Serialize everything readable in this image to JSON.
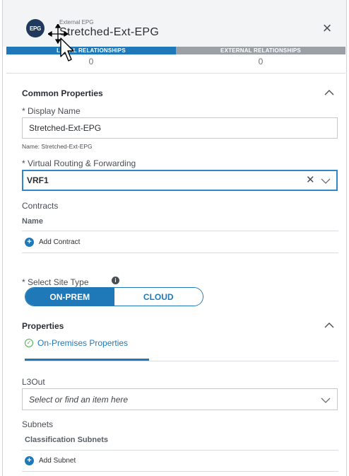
{
  "header": {
    "badge": "EPG",
    "object_type": "External EPG",
    "object_name": "Stretched-Ext-EPG",
    "close_label": "×"
  },
  "tabs": [
    {
      "label": "LOCAL RELATIONSHIPS",
      "count": "0",
      "active": true
    },
    {
      "label": "EXTERNAL RELATIONSHIPS",
      "count": "0",
      "active": false
    }
  ],
  "common": {
    "title": "Common Properties",
    "display_name_label": "* Display Name",
    "display_name_value": "Stretched-Ext-EPG",
    "name_hint": "Name: Stretched-Ext-EPG",
    "vrf_label": "* Virtual Routing & Forwarding",
    "vrf_value": "VRF1",
    "contracts_label": "Contracts",
    "contracts_col_header": "Name",
    "add_contract": "Add Contract"
  },
  "site_type": {
    "label": "* Select Site Type",
    "info_icon": "i",
    "options": [
      "ON-PREM",
      "CLOUD"
    ],
    "selected": "ON-PREM"
  },
  "properties": {
    "title": "Properties",
    "sub_tab": "On-Premises Properties",
    "l3out_label": "L3Out",
    "l3out_placeholder": "Select or find an item here",
    "subnets_label": "Subnets",
    "subnets_col_header": "Classification Subnets",
    "add_subnet": "Add Subnet"
  },
  "colors": {
    "accent": "#1f79b8",
    "tab_inactive": "#9aa0a6",
    "success": "#4caf50"
  }
}
